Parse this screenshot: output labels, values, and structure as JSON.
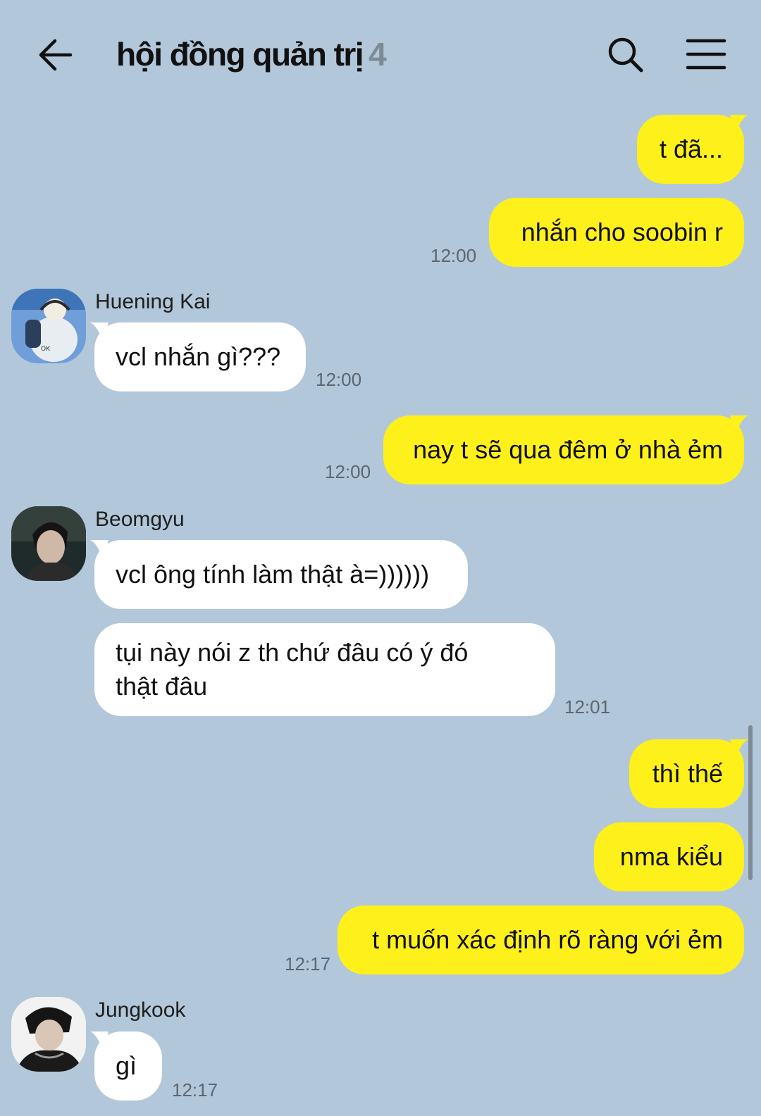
{
  "header": {
    "back_icon": "arrow-left-icon",
    "title": "hội đồng quản trị",
    "member_count": "4",
    "search_icon": "search-icon",
    "menu_icon": "hamburger-menu-icon"
  },
  "colors": {
    "background": "#b2c7da",
    "my_bubble": "#fef01b",
    "their_bubble": "#ffffff"
  },
  "messages": [
    {
      "from": "me",
      "text": "t đã..."
    },
    {
      "from": "me",
      "text": "nhắn cho soobin r",
      "time": "12:00"
    },
    {
      "from": "Huening Kai",
      "text": "vcl nhắn gì???",
      "time": "12:00"
    },
    {
      "from": "me",
      "text": "nay t sẽ qua đêm ở nhà ẻm",
      "time": "12:00"
    },
    {
      "from": "Beomgyu",
      "text": "vcl ông tính làm thật à=))))))"
    },
    {
      "from": "Beomgyu",
      "text": "tụi này nói z th chứ đâu có ý đó thật đâu",
      "time": "12:01"
    },
    {
      "from": "me",
      "text": "thì thế"
    },
    {
      "from": "me",
      "text": "nma kiểu"
    },
    {
      "from": "me",
      "text": "t muốn xác định rõ ràng với ẻm",
      "time": "12:17"
    },
    {
      "from": "Jungkook",
      "text": "gì",
      "time": "12:17"
    }
  ],
  "senders": {
    "huening_kai": "Huening Kai",
    "beomgyu": "Beomgyu",
    "jungkook": "Jungkook"
  }
}
